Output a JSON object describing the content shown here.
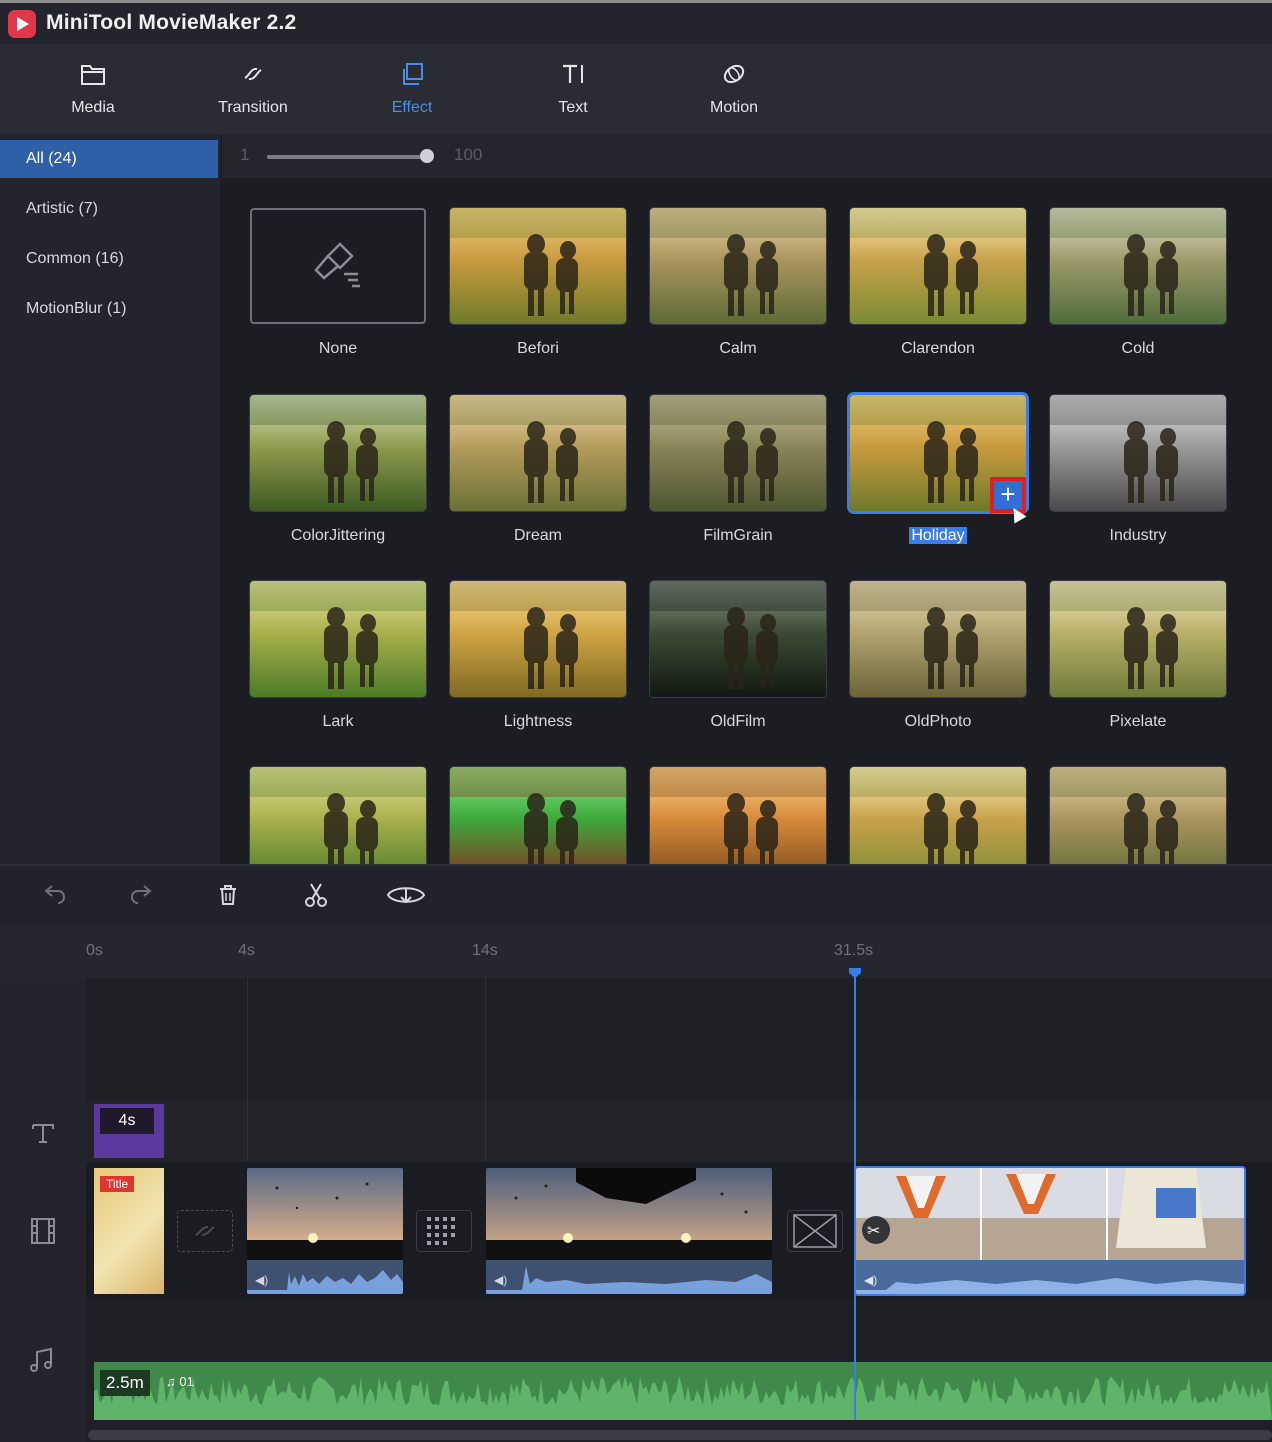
{
  "app": {
    "title": "MiniTool MovieMaker 2.2"
  },
  "toolbar": {
    "items": [
      {
        "label": "Media",
        "icon": "folder-icon",
        "active": false
      },
      {
        "label": "Transition",
        "icon": "transition-icon",
        "active": false
      },
      {
        "label": "Effect",
        "icon": "effect-icon",
        "active": true
      },
      {
        "label": "Text",
        "icon": "text-icon",
        "active": false
      },
      {
        "label": "Motion",
        "icon": "motion-icon",
        "active": false
      }
    ],
    "accent": "#4d8be8"
  },
  "sidebar": {
    "categories": [
      {
        "label": "All (24)",
        "active": true
      },
      {
        "label": "Artistic (7)",
        "active": false
      },
      {
        "label": "Common (16)",
        "active": false
      },
      {
        "label": "MotionBlur (1)",
        "active": false
      }
    ]
  },
  "intensity": {
    "min_label": "1",
    "max_label": "100",
    "value": 100
  },
  "effects": [
    {
      "name": "None",
      "tone": "none"
    },
    {
      "name": "Befori",
      "tone": "warm"
    },
    {
      "name": "Calm",
      "tone": "calm"
    },
    {
      "name": "Clarendon",
      "tone": "bright"
    },
    {
      "name": "Cold",
      "tone": "cold"
    },
    {
      "name": "ColorJittering",
      "tone": "jitter"
    },
    {
      "name": "Dream",
      "tone": "dream"
    },
    {
      "name": "FilmGrain",
      "tone": "grain"
    },
    {
      "name": "Holiday",
      "tone": "warm",
      "selected": true
    },
    {
      "name": "Industry",
      "tone": "gray"
    },
    {
      "name": "Lark",
      "tone": "lark"
    },
    {
      "name": "Lightness",
      "tone": "light"
    },
    {
      "name": "OldFilm",
      "tone": "dark"
    },
    {
      "name": "OldPhoto",
      "tone": "old"
    },
    {
      "name": "Pixelate",
      "tone": "pix"
    },
    {
      "name": "",
      "tone": "lark"
    },
    {
      "name": "",
      "tone": "green"
    },
    {
      "name": "",
      "tone": "orange"
    },
    {
      "name": "",
      "tone": "bright"
    },
    {
      "name": "",
      "tone": "calm"
    }
  ],
  "add_button": {
    "label": "+"
  },
  "timeline": {
    "ruler_ticks": [
      "0s",
      "4s",
      "14s",
      "31.5s"
    ],
    "title_clip": {
      "duration": "4s"
    },
    "video_title_badge": "Title",
    "music": {
      "duration": "2.5m",
      "name": "01"
    },
    "playhead_time": "31.5s"
  }
}
